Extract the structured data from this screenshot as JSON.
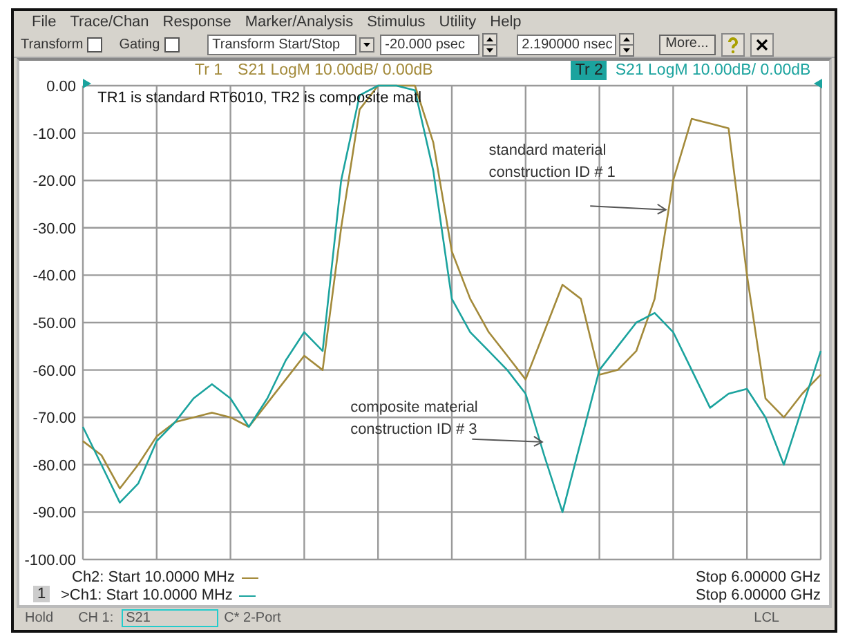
{
  "menu": [
    "File",
    "Trace/Chan",
    "Response",
    "Marker/Analysis",
    "Stimulus",
    "Utility",
    "Help"
  ],
  "toolbar": {
    "checkboxes": [
      {
        "label": "Transform",
        "checked": false
      },
      {
        "label": "Gating",
        "checked": false
      }
    ],
    "mode": "Transform Start/Stop",
    "fields": [
      {
        "value": "-20.000 psec"
      },
      {
        "value": "2.190000 nsec"
      }
    ],
    "more_button": "More..."
  },
  "plot": {
    "traces": [
      {
        "text": "S21 LogM 10.00dB/  0.00dB",
        "selected": false
      },
      {
        "text": "S21 LogM 10.00dB/  0.00dB",
        "selected": true
      }
    ],
    "callouts": [
      {
        "kind": "note",
        "text": "TR1 is standard RT6010, TR2 is composite matl"
      },
      {
        "kind": "arrow",
        "text": "standard material construction ID # 1"
      },
      {
        "kind": "arrow",
        "text": "composite material construction ID # 3"
      }
    ],
    "chart_data": {
      "type": "line",
      "ylim": [
        -100,
        0
      ],
      "grid": true,
      "yticks": [
        {
          "value": 0,
          "label": "0.00"
        },
        {
          "value": -10,
          "label": "-10.00"
        },
        {
          "value": -20,
          "label": "-20.00"
        },
        {
          "value": -30,
          "label": "-30.00"
        },
        {
          "value": -40,
          "label": "-40.00"
        },
        {
          "value": -50,
          "label": "-50.00"
        },
        {
          "value": -60,
          "label": "-60.00"
        },
        {
          "value": -70,
          "label": "-70.00"
        },
        {
          "value": -80,
          "label": "-80.00"
        },
        {
          "value": -90,
          "label": "-90.00"
        },
        {
          "value": -100,
          "label": "-100.00"
        }
      ],
      "series": [
        {
          "name": "Tr 1",
          "color": "#a38a3a",
          "values": [
            -75,
            -78,
            -85,
            -80,
            -74,
            -71,
            -70,
            -69,
            -70,
            -72,
            -67,
            -62,
            -57,
            -60,
            -30,
            -5,
            0,
            0,
            0,
            -12,
            -35,
            -45,
            -52,
            -57,
            -62,
            -52,
            -42,
            -45,
            -61,
            -60,
            -56,
            -45,
            -20,
            -7,
            -8,
            -9,
            -40,
            -66,
            -70,
            -65,
            -61
          ]
        },
        {
          "name": "Tr 2",
          "color": "#1ba39e",
          "values": [
            -72,
            -80,
            -88,
            -84,
            -75,
            -71,
            -66,
            -63,
            -66,
            -72,
            -66,
            -58,
            -52,
            -56,
            -20,
            -2,
            0,
            0,
            -1,
            -18,
            -45,
            -52,
            -56,
            -60,
            -65,
            -78,
            -90,
            -75,
            -60,
            -55,
            -50,
            -48,
            -52,
            -60,
            -68,
            -65,
            -64,
            -70,
            -80,
            -68,
            -56
          ]
        }
      ]
    },
    "channel": "1",
    "footer": [
      {
        "start": "Ch2: Start  10.0000 MHz",
        "stop": "Stop  6.00000 GHz"
      },
      {
        "start": ">Ch1: Start  10.0000 MHz",
        "stop": "Stop  6.00000 GHz"
      }
    ]
  },
  "status_bar": {
    "state": "Hold",
    "channel": "CH 1:",
    "measurement": "S21",
    "calibration": "C* 2-Port",
    "control": "LCL"
  }
}
